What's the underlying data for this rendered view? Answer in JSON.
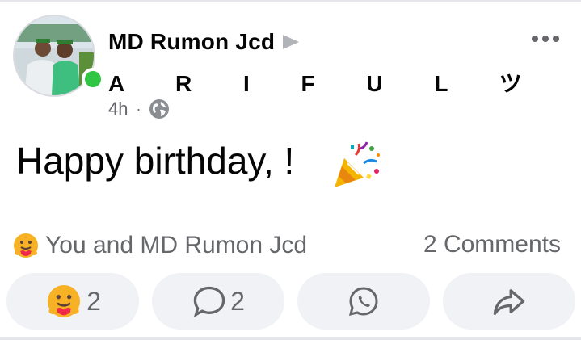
{
  "post": {
    "author": "MD Rumon Jcd",
    "target": "A R I F U L ツ",
    "time": "4h",
    "separator": "·",
    "text": "Happy birthday, !"
  },
  "summary": {
    "reactions_text": "You and MD Rumon Jcd",
    "comments_text": "2 Comments"
  },
  "actions": {
    "react_count": "2",
    "comment_count": "2"
  },
  "icons": {
    "privacy": "globe-icon",
    "reaction": "care-emoji-icon",
    "comment": "comment-bubble-icon",
    "whatsapp": "whatsapp-icon",
    "share": "share-arrow-icon",
    "celebration": "party-popper-icon"
  },
  "colors": {
    "online": "#31c545",
    "secondary_text": "#65676b",
    "button_bg": "#f0f2f5"
  }
}
